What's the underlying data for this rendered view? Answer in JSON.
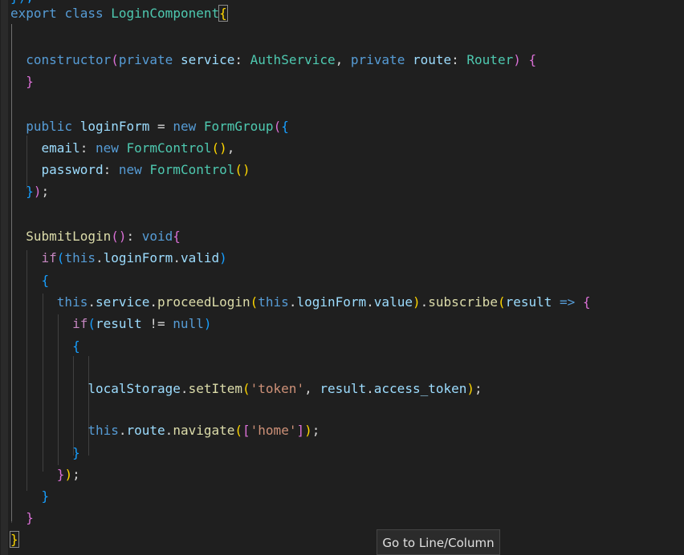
{
  "editor": {
    "language": "typescript",
    "top_fragment": "});",
    "lines": [
      "export class LoginComponent{",
      "",
      "  constructor(private service: AuthService, private route: Router) {",
      "  }",
      "",
      "  public loginForm = new FormGroup({",
      "    email: new FormControl(),",
      "    password: new FormControl()",
      "  });",
      "",
      "  SubmitLogin(): void{",
      "    if(this.loginForm.valid)",
      "    {",
      "      this.service.proceedLogin(this.loginForm.value).subscribe(result => {",
      "        if(result != null)",
      "        {",
      "",
      "          localStorage.setItem('token', result.access_token);",
      "",
      "          this.route.navigate(['home']);",
      "        }",
      "      });",
      "    }",
      "  }",
      "}"
    ]
  },
  "tooltip": {
    "text": "Go to Line/Column"
  },
  "colors": {
    "background": "#1f1f1f",
    "keyword": "#569cd6",
    "control": "#c586c0",
    "type": "#4ec9b0",
    "variable": "#9cdcfe",
    "function": "#dcdcaa",
    "string": "#ce9178",
    "bracket_level_1": "#ffd700",
    "bracket_level_2": "#da70d6",
    "bracket_level_3": "#179fff"
  }
}
